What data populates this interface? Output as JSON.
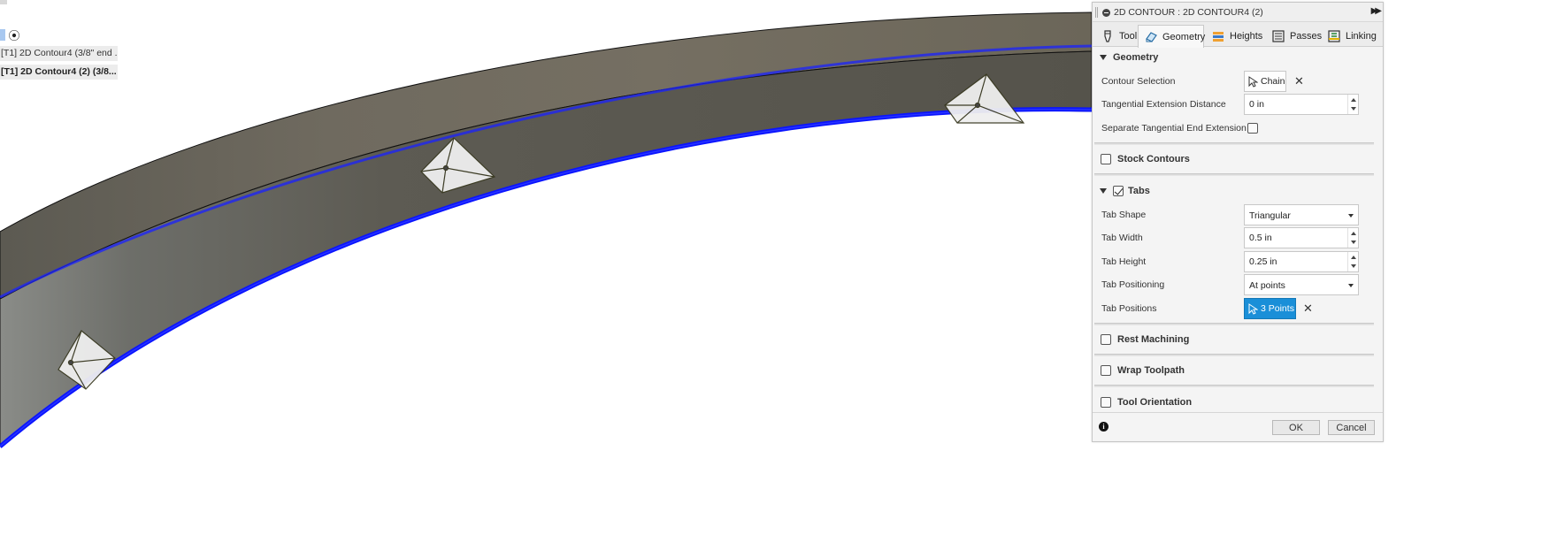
{
  "browser": {
    "items": [
      "[T1] 2D Contour4 (3/8\" end ...",
      "[T1] 2D Contour4 (2) (3/8..."
    ]
  },
  "panel": {
    "title": "2D CONTOUR : 2D CONTOUR4 (2)",
    "tabs": [
      "Tool",
      "Geometry",
      "Heights",
      "Passes",
      "Linking"
    ],
    "active_tab": "Geometry",
    "geometry": {
      "heading": "Geometry",
      "contour_selection_label": "Contour Selection",
      "contour_selection_button": "Chain",
      "tangential_label": "Tangential Extension Distance",
      "tangential_value": "0 in",
      "separate_label": "Separate Tangential End Extension",
      "separate_checked": false
    },
    "stock_contours": {
      "label": "Stock Contours",
      "checked": false
    },
    "tabs_section": {
      "label": "Tabs",
      "checked": true,
      "tab_shape_label": "Tab Shape",
      "tab_shape_value": "Triangular",
      "tab_width_label": "Tab Width",
      "tab_width_value": "0.5 in",
      "tab_height_label": "Tab Height",
      "tab_height_value": "0.25 in",
      "tab_positioning_label": "Tab Positioning",
      "tab_positioning_value": "At points",
      "tab_positions_label": "Tab Positions",
      "tab_positions_button": "3 Points"
    },
    "rest_machining": {
      "label": "Rest Machining",
      "checked": false
    },
    "wrap_toolpath": {
      "label": "Wrap Toolpath",
      "checked": false
    },
    "tool_orientation": {
      "label": "Tool Orientation",
      "checked": false
    },
    "ok_label": "OK",
    "cancel_label": "Cancel"
  },
  "colors": {
    "toolpath_blue": "#0a14ff",
    "part_face": "#6e6a62",
    "selected_button": "#1a8fd8"
  }
}
